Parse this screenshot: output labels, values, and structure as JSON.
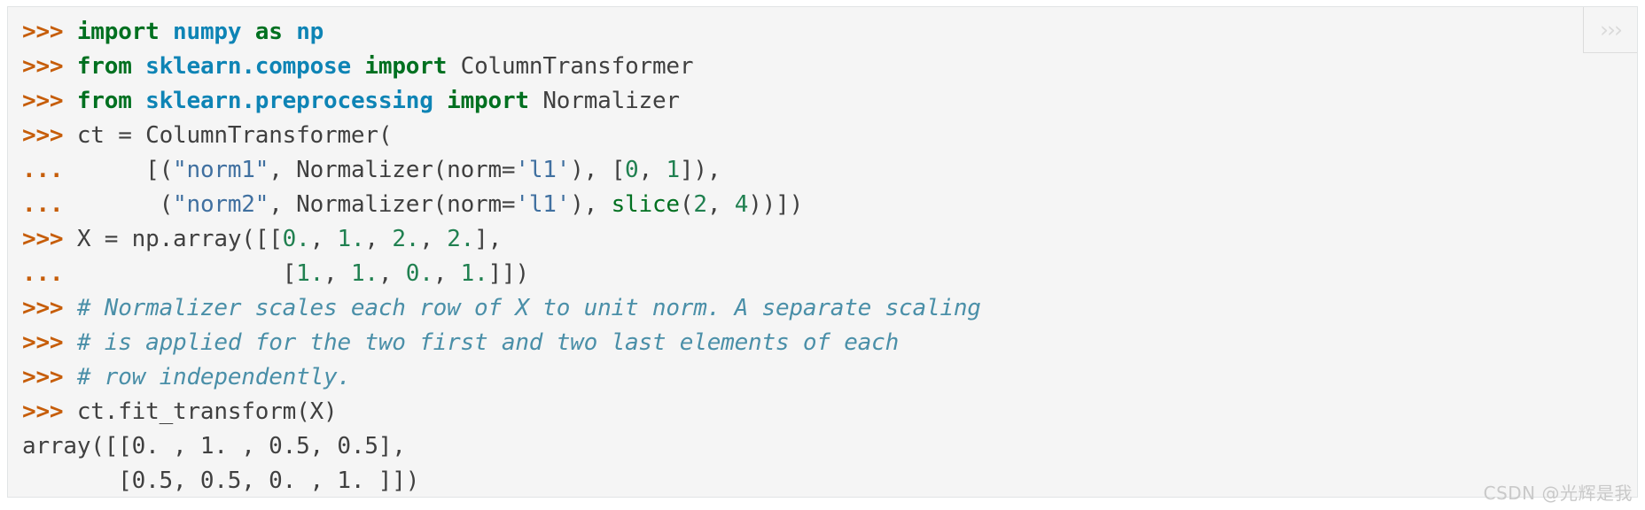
{
  "block": {
    "language": "python-doctest",
    "background_color": "#f5f5f5",
    "border_color": "#e1e4e5"
  },
  "copy_button": {
    "icon": "chevron-triple-right-icon",
    "glyph": "›››",
    "color": "#dadada"
  },
  "watermark": {
    "text": "CSDN @光辉是我",
    "color": "#c9c9c9"
  },
  "colors": {
    "prompt": "#c65d09",
    "keyword": "#007020",
    "module": "#0e84b5",
    "number": "#208050",
    "string": "#4070a0",
    "builtin": "#007020",
    "comment": "#4a8fa8",
    "text": "#404040"
  },
  "code": {
    "lines": [
      {
        "kind": "input",
        "prompt": ">>>",
        "plain": "import numpy as np",
        "tokens": [
          {
            "t": "kw",
            "v": "import"
          },
          {
            "t": "punc",
            "v": " "
          },
          {
            "t": "mod",
            "v": "numpy"
          },
          {
            "t": "punc",
            "v": " "
          },
          {
            "t": "kw",
            "v": "as"
          },
          {
            "t": "punc",
            "v": " "
          },
          {
            "t": "mod",
            "v": "np"
          }
        ]
      },
      {
        "kind": "input",
        "prompt": ">>>",
        "plain": "from sklearn.compose import ColumnTransformer",
        "tokens": [
          {
            "t": "kw",
            "v": "from"
          },
          {
            "t": "punc",
            "v": " "
          },
          {
            "t": "mod",
            "v": "sklearn.compose"
          },
          {
            "t": "punc",
            "v": " "
          },
          {
            "t": "kw",
            "v": "import"
          },
          {
            "t": "punc",
            "v": " "
          },
          {
            "t": "cls",
            "v": "ColumnTransformer"
          }
        ]
      },
      {
        "kind": "input",
        "prompt": ">>>",
        "plain": "from sklearn.preprocessing import Normalizer",
        "tokens": [
          {
            "t": "kw",
            "v": "from"
          },
          {
            "t": "punc",
            "v": " "
          },
          {
            "t": "mod",
            "v": "sklearn.preprocessing"
          },
          {
            "t": "punc",
            "v": " "
          },
          {
            "t": "kw",
            "v": "import"
          },
          {
            "t": "punc",
            "v": " "
          },
          {
            "t": "cls",
            "v": "Normalizer"
          }
        ]
      },
      {
        "kind": "input",
        "prompt": ">>>",
        "plain": "ct = ColumnTransformer(",
        "tokens": [
          {
            "t": "name",
            "v": "ct = ColumnTransformer("
          }
        ]
      },
      {
        "kind": "continuation",
        "prompt": "...",
        "plain": "     [(\"norm1\", Normalizer(norm='l1'), [0, 1]),",
        "tokens": [
          {
            "t": "punc",
            "v": "     [("
          },
          {
            "t": "str",
            "v": "\"norm1\""
          },
          {
            "t": "punc",
            "v": ", Normalizer(norm="
          },
          {
            "t": "str",
            "v": "'l1'"
          },
          {
            "t": "punc",
            "v": "), ["
          },
          {
            "t": "num",
            "v": "0"
          },
          {
            "t": "punc",
            "v": ", "
          },
          {
            "t": "num",
            "v": "1"
          },
          {
            "t": "punc",
            "v": "]),"
          }
        ]
      },
      {
        "kind": "continuation",
        "prompt": "...",
        "plain": "      (\"norm2\", Normalizer(norm='l1'), slice(2, 4))])",
        "tokens": [
          {
            "t": "punc",
            "v": "      ("
          },
          {
            "t": "str",
            "v": "\"norm2\""
          },
          {
            "t": "punc",
            "v": ", Normalizer(norm="
          },
          {
            "t": "str",
            "v": "'l1'"
          },
          {
            "t": "punc",
            "v": "), "
          },
          {
            "t": "bltn",
            "v": "slice"
          },
          {
            "t": "punc",
            "v": "("
          },
          {
            "t": "num",
            "v": "2"
          },
          {
            "t": "punc",
            "v": ", "
          },
          {
            "t": "num",
            "v": "4"
          },
          {
            "t": "punc",
            "v": "))])"
          }
        ]
      },
      {
        "kind": "input",
        "prompt": ">>>",
        "plain": "X = np.array([[0., 1., 2., 2.],",
        "tokens": [
          {
            "t": "name",
            "v": "X = np.array([["
          },
          {
            "t": "num",
            "v": "0."
          },
          {
            "t": "punc",
            "v": ", "
          },
          {
            "t": "num",
            "v": "1."
          },
          {
            "t": "punc",
            "v": ", "
          },
          {
            "t": "num",
            "v": "2."
          },
          {
            "t": "punc",
            "v": ", "
          },
          {
            "t": "num",
            "v": "2."
          },
          {
            "t": "punc",
            "v": "],"
          }
        ]
      },
      {
        "kind": "continuation",
        "prompt": "...",
        "plain": "               [1., 1., 0., 1.]])",
        "tokens": [
          {
            "t": "punc",
            "v": "               ["
          },
          {
            "t": "num",
            "v": "1."
          },
          {
            "t": "punc",
            "v": ", "
          },
          {
            "t": "num",
            "v": "1."
          },
          {
            "t": "punc",
            "v": ", "
          },
          {
            "t": "num",
            "v": "0."
          },
          {
            "t": "punc",
            "v": ", "
          },
          {
            "t": "num",
            "v": "1."
          },
          {
            "t": "punc",
            "v": "]])"
          }
        ]
      },
      {
        "kind": "input",
        "prompt": ">>>",
        "plain": "# Normalizer scales each row of X to unit norm. A separate scaling",
        "tokens": [
          {
            "t": "comment",
            "v": "# Normalizer scales each row of X to unit norm. A separate scaling"
          }
        ]
      },
      {
        "kind": "input",
        "prompt": ">>>",
        "plain": "# is applied for the two first and two last elements of each",
        "tokens": [
          {
            "t": "comment",
            "v": "# is applied for the two first and two last elements of each"
          }
        ]
      },
      {
        "kind": "input",
        "prompt": ">>>",
        "plain": "# row independently.",
        "tokens": [
          {
            "t": "comment",
            "v": "# row independently."
          }
        ]
      },
      {
        "kind": "input",
        "prompt": ">>>",
        "plain": "ct.fit_transform(X)",
        "tokens": [
          {
            "t": "name",
            "v": "ct.fit_transform(X)"
          }
        ]
      },
      {
        "kind": "output",
        "prompt": "",
        "plain": "array([[0. , 1. , 0.5, 0.5],",
        "tokens": [
          {
            "t": "out",
            "v": "array([[0. , 1. , 0.5, 0.5],"
          }
        ]
      },
      {
        "kind": "output",
        "prompt": "",
        "plain": "       [0.5, 0.5, 0. , 1. ]])",
        "tokens": [
          {
            "t": "out",
            "v": "       [0.5, 0.5, 0. , 1. ]])"
          }
        ]
      }
    ]
  }
}
